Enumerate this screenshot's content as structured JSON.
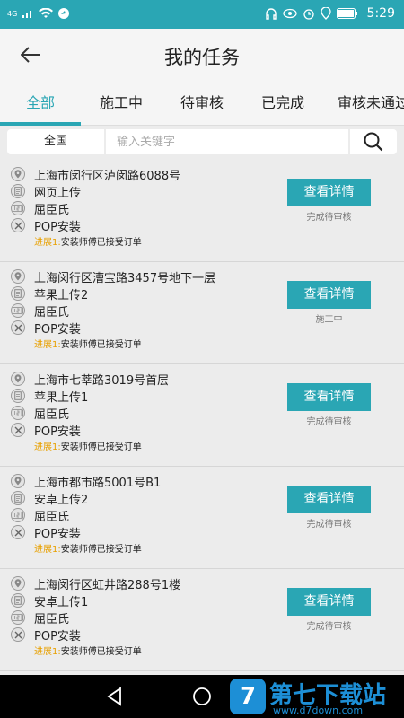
{
  "status_bar": {
    "network": "4G",
    "time": "5:29"
  },
  "header": {
    "title": "我的任务"
  },
  "tabs": [
    {
      "label": "全部",
      "active": true
    },
    {
      "label": "施工中"
    },
    {
      "label": "待审核"
    },
    {
      "label": "已完成"
    },
    {
      "label": "审核未通过"
    }
  ],
  "search": {
    "region": "全国",
    "placeholder": "输入关键字"
  },
  "tasks": [
    {
      "address": "上海市闵行区泸闵路6088号",
      "upload": "网页上传",
      "name": "屈臣氏",
      "type": "POP安装",
      "progress_label": "进展1:",
      "progress_text": "安装师傅已接受订单",
      "button": "查看详情",
      "status": "完成待审核"
    },
    {
      "address": "上海闵行区漕宝路3457号地下一层",
      "upload": "苹果上传2",
      "name": "屈臣氏",
      "type": "POP安装",
      "progress_label": "进展1:",
      "progress_text": "安装师傅已接受订单",
      "button": "查看详情",
      "status": "施工中"
    },
    {
      "address": "上海市七莘路3019号首层",
      "upload": "苹果上传1",
      "name": "屈臣氏",
      "type": "POP安装",
      "progress_label": "进展1:",
      "progress_text": "安装师傅已接受订单",
      "button": "查看详情",
      "status": "完成待审核"
    },
    {
      "address": "上海市都市路5001号B1",
      "upload": "安卓上传2",
      "name": "屈臣氏",
      "type": "POP安装",
      "progress_label": "进展1:",
      "progress_text": "安装师傅已接受订单",
      "button": "查看详情",
      "status": "完成待审核"
    },
    {
      "address": "上海闵行区虹井路288号1楼",
      "upload": "安卓上传1",
      "name": "屈臣氏",
      "type": "POP安装",
      "progress_label": "进展1:",
      "progress_text": "安装师傅已接受订单",
      "button": "查看详情",
      "status": "完成待审核"
    }
  ],
  "watermark": {
    "text": "第七下载站",
    "url": "www.d7down.com",
    "logo": "7"
  },
  "colors": {
    "accent": "#2aa6b4",
    "progress_label": "#e8a000",
    "watermark": "#1d8fd6"
  }
}
